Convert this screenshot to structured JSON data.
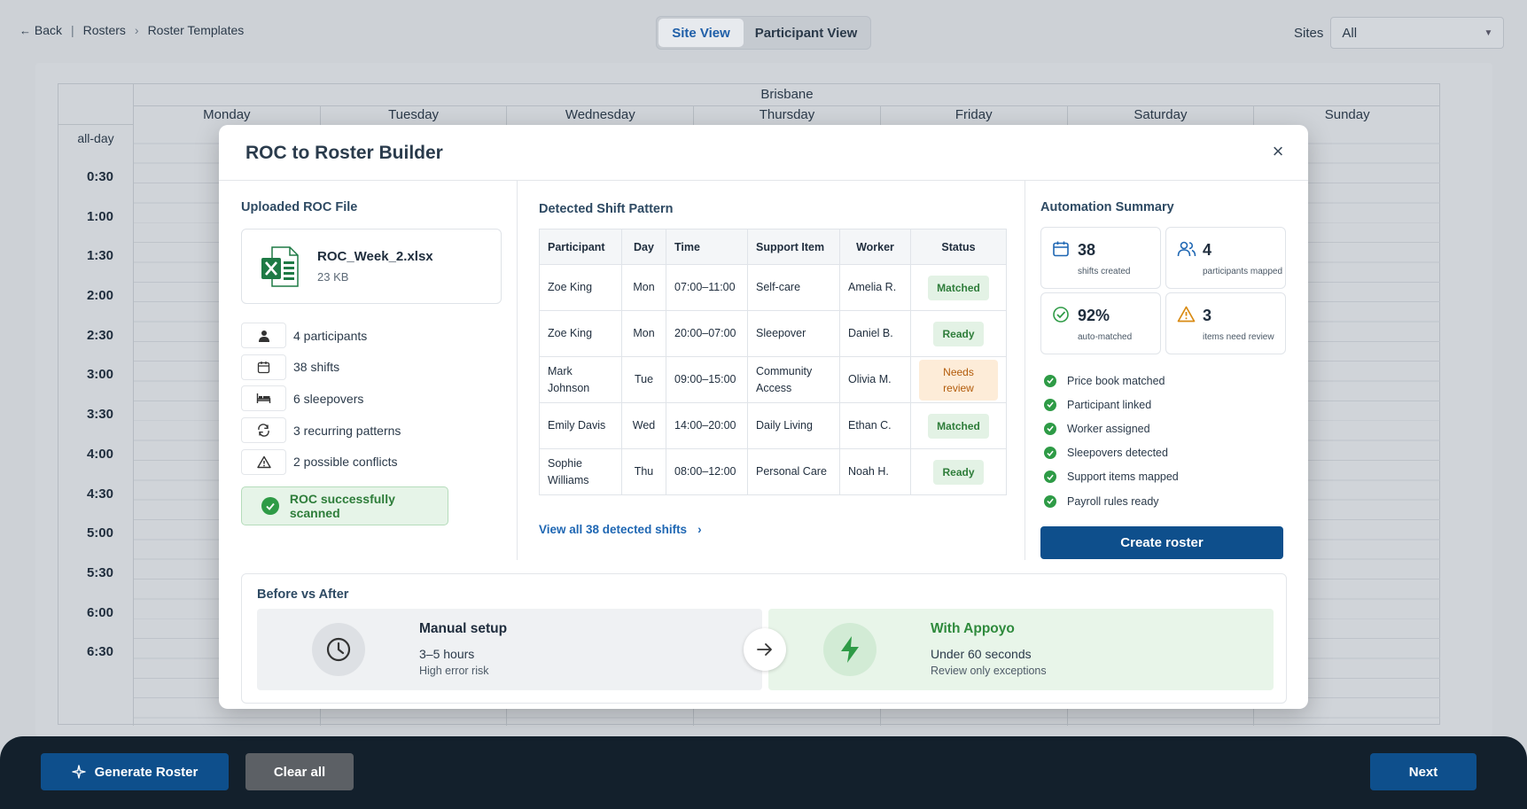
{
  "breadcrumb": {
    "back": "Back",
    "sep": "|",
    "rosters": "Rosters",
    "chevron": "›",
    "current": "Roster Templates"
  },
  "view_toggle": {
    "site": "Site View",
    "participant": "Participant View",
    "active": "Site View"
  },
  "sites": {
    "label": "Sites",
    "value": "All"
  },
  "calendar": {
    "site": "Brisbane",
    "days": [
      "Monday",
      "Tuesday",
      "Wednesday",
      "Thursday",
      "Friday",
      "Saturday",
      "Sunday"
    ],
    "allday": "all-day",
    "times": [
      "0:30",
      "1:00",
      "1:30",
      "2:00",
      "2:30",
      "3:00",
      "3:30",
      "4:00",
      "4:30",
      "5:00",
      "5:30",
      "6:00",
      "6:30"
    ]
  },
  "modal": {
    "title": "ROC to Roster Builder",
    "close": "×",
    "uploaded": {
      "title": "Uploaded ROC File",
      "file_name": "ROC_Week_2.xlsx",
      "file_size": "23 KB",
      "stats": [
        {
          "icon": "person-icon",
          "label": "4 participants"
        },
        {
          "icon": "calendar-icon",
          "label": "38 shifts"
        },
        {
          "icon": "bed-icon",
          "label": "6 sleepovers"
        },
        {
          "icon": "repeat-icon",
          "label": "3 recurring patterns"
        },
        {
          "icon": "warning-icon",
          "label": "2 possible conflicts"
        }
      ],
      "scan_status": "ROC successfully scanned"
    },
    "pattern": {
      "title": "Detected Shift Pattern",
      "columns": [
        "Participant",
        "Day",
        "Time",
        "Support Item",
        "Worker",
        "Status"
      ],
      "rows": [
        {
          "participant": "Zoe King",
          "day": "Mon",
          "time": "07:00–11:00",
          "support": "Self-care",
          "worker": "Amelia R.",
          "status": "Matched"
        },
        {
          "participant": "Zoe King",
          "day": "Mon",
          "time": "20:00–07:00",
          "support": "Sleepover",
          "worker": "Daniel B.",
          "status": "Ready"
        },
        {
          "participant": "Mark Johnson",
          "day": "Tue",
          "time": "09:00–15:00",
          "support": "Community Access",
          "worker": "Olivia M.",
          "status": "Needs review"
        },
        {
          "participant": "Emily Davis",
          "day": "Wed",
          "time": "14:00–20:00",
          "support": "Daily Living",
          "worker": "Ethan C.",
          "status": "Matched"
        },
        {
          "participant": "Sophie Williams",
          "day": "Thu",
          "time": "08:00–12:00",
          "support": "Personal Care",
          "worker": "Noah H.",
          "status": "Ready"
        }
      ],
      "view_all": "View all 38 detected shifts"
    },
    "summary": {
      "title": "Automation Summary",
      "kpis": [
        {
          "icon": "calendar-icon",
          "value": "38",
          "label": "shifts created"
        },
        {
          "icon": "people-icon",
          "value": "4",
          "label": "participants mapped"
        },
        {
          "icon": "check-circle-icon",
          "value": "92%",
          "label": "auto-matched"
        },
        {
          "icon": "warning-icon",
          "value": "3",
          "label": "items need review"
        }
      ],
      "checks": [
        "Price book matched",
        "Participant linked",
        "Worker assigned",
        "Sleepovers detected",
        "Support items mapped",
        "Payroll rules ready"
      ],
      "create_button": "Create roster"
    },
    "before_after": {
      "title": "Before vs After",
      "manual": {
        "title": "Manual setup",
        "main": "3–5 hours",
        "sub": "High error risk"
      },
      "appoyo": {
        "title": "With Appoyo",
        "main": "Under 60 seconds",
        "sub": "Review only exceptions"
      }
    }
  },
  "footer": {
    "generate": "Generate Roster",
    "clear": "Clear all",
    "next": "Next"
  },
  "colors": {
    "primary": "#0e4f8c",
    "success": "#2e9b46",
    "warning": "#d98a12",
    "footer_bg": "#13202c"
  }
}
